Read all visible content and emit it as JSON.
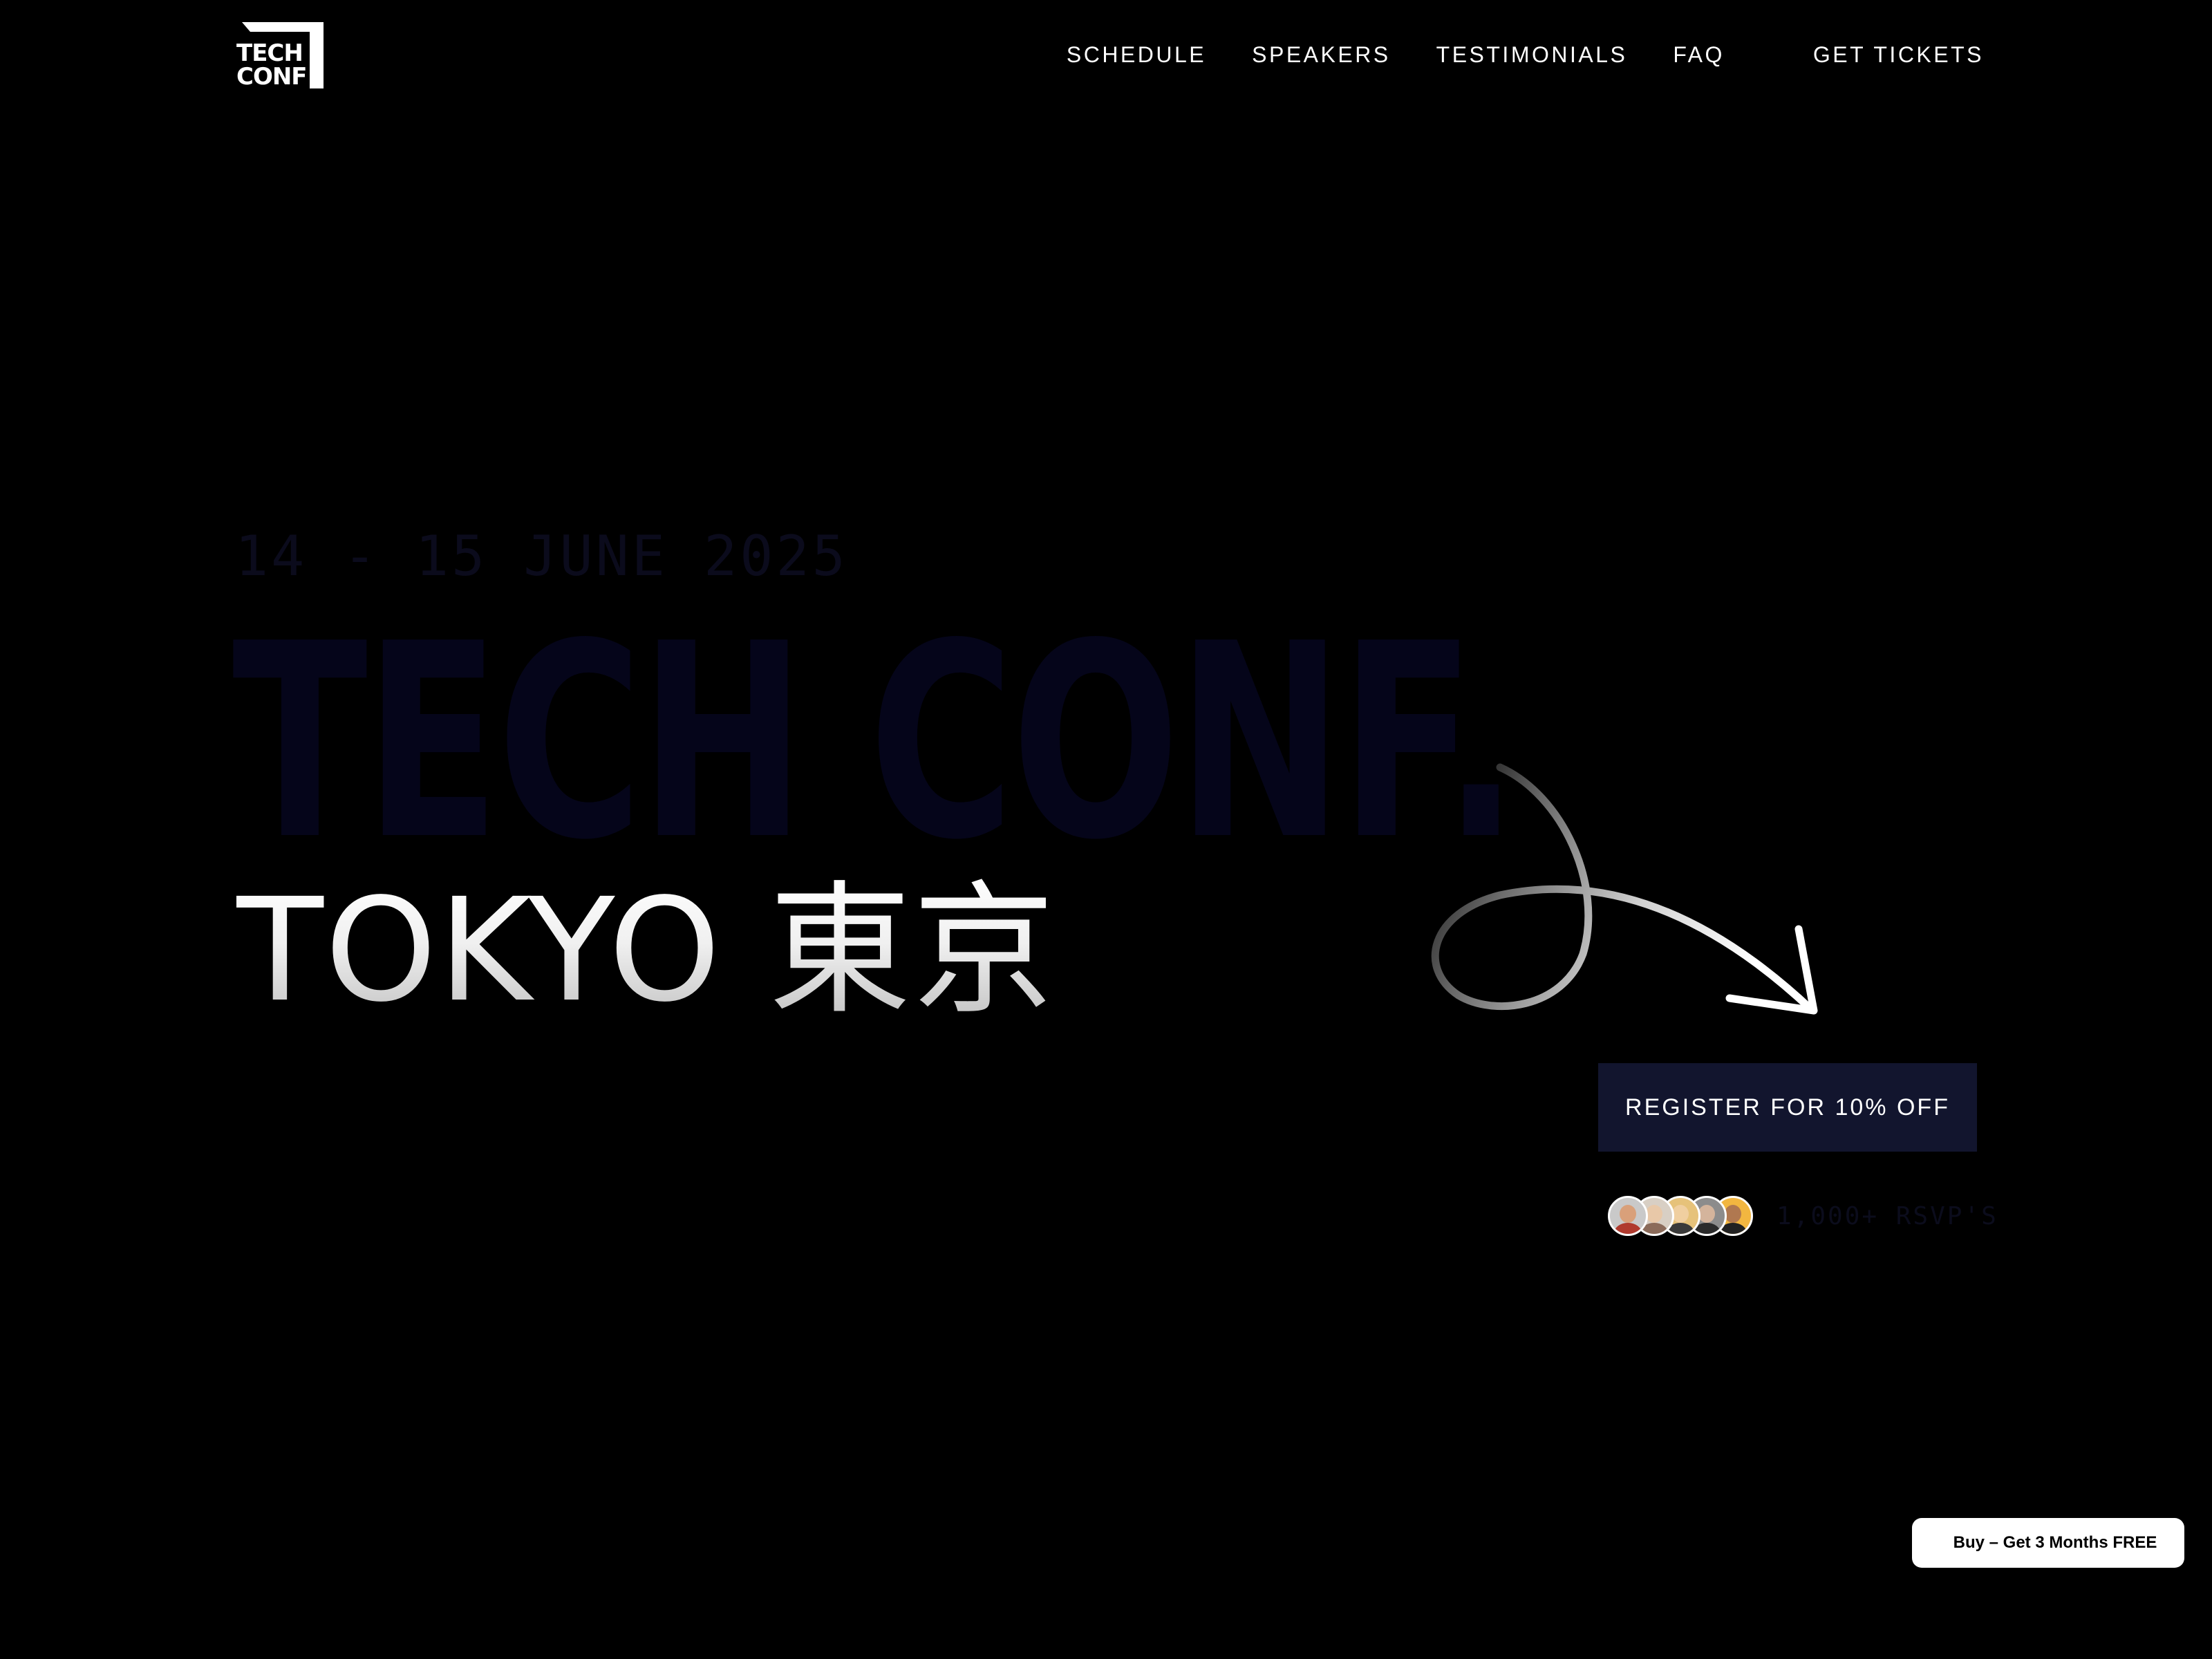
{
  "logo": {
    "line1": "TECH",
    "line2": "CONF",
    "icon": "techconf-logo-icon"
  },
  "nav": {
    "items": [
      {
        "label": "SCHEDULE"
      },
      {
        "label": "SPEAKERS"
      },
      {
        "label": "TESTIMONIALS"
      },
      {
        "label": "FAQ"
      }
    ],
    "cta_label": "GET TICKETS"
  },
  "hero": {
    "date": "14 - 15 JUNE 2025",
    "title": "TECH CONF.",
    "city": "TOKYO 東京",
    "arrow_icon": "curly-arrow-icon",
    "register_label": "REGISTER FOR 10% OFF",
    "rsvp_text": "1,000+ RSVP'S",
    "avatars": [
      {
        "icon": "attendee-avatar-1",
        "bg": "#c9c9c9",
        "face": "#d9a07a",
        "body": "#b03a2e"
      },
      {
        "icon": "attendee-avatar-2",
        "bg": "#d8cfc4",
        "face": "#e8c8a8",
        "body": "#8b6b5a"
      },
      {
        "icon": "attendee-avatar-3",
        "bg": "#e6c27a",
        "face": "#f0cfa0",
        "body": "#3a3a3a"
      },
      {
        "icon": "attendee-avatar-4",
        "bg": "#8c8c8c",
        "face": "#d4b49c",
        "body": "#2b2b2b"
      },
      {
        "icon": "attendee-avatar-5",
        "bg": "#f2b640",
        "face": "#b07850",
        "body": "#222222"
      }
    ]
  },
  "badge": {
    "label": "Buy – Get 3 Months FREE"
  },
  "colors": {
    "background": "#000000",
    "title_dark": "#05051a",
    "cta_bg": "#12152e",
    "text": "#ffffff"
  }
}
